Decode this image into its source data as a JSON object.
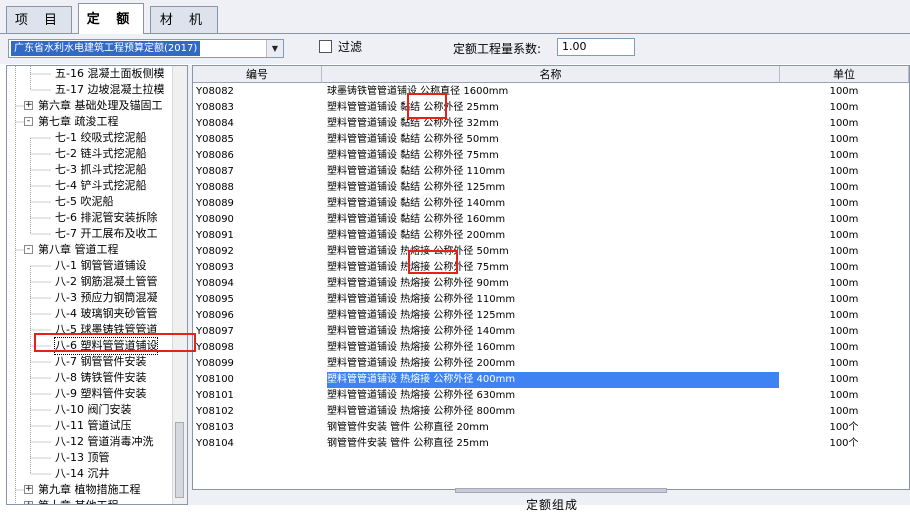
{
  "tabs": [
    {
      "label": "项 目",
      "active": false
    },
    {
      "label": "定 额",
      "active": true
    },
    {
      "label": "材 机",
      "active": false
    }
  ],
  "toolbar": {
    "quota_set": "广东省水利水电建筑工程预算定额(2017)",
    "filter_label": "过滤",
    "coef_label": "定额工程量系数:",
    "coef_value": "1.00"
  },
  "tree": [
    {
      "label": "五-16 混凝土面板侧模",
      "level": 2
    },
    {
      "label": "五-17 边坡混凝土拉模",
      "level": 2
    },
    {
      "label": "第六章 基础处理及锚固工",
      "level": 1,
      "expander": "+"
    },
    {
      "label": "第七章 疏浚工程",
      "level": 1,
      "expander": "-"
    },
    {
      "label": "七-1 绞吸式挖泥船",
      "level": 2
    },
    {
      "label": "七-2 链斗式挖泥船",
      "level": 2
    },
    {
      "label": "七-3 抓斗式挖泥船",
      "level": 2
    },
    {
      "label": "七-4 铲斗式挖泥船",
      "level": 2
    },
    {
      "label": "七-5 吹泥船",
      "level": 2
    },
    {
      "label": "七-6 排泥管安装拆除",
      "level": 2
    },
    {
      "label": "七-7 开工展布及收工",
      "level": 2
    },
    {
      "label": "第八章 管道工程",
      "level": 1,
      "expander": "-"
    },
    {
      "label": "八-1 钢管管道铺设",
      "level": 2
    },
    {
      "label": "八-2 钢筋混凝土管管",
      "level": 2
    },
    {
      "label": "八-3 预应力钢筒混凝",
      "level": 2
    },
    {
      "label": "八-4 玻璃钢夹砂管管",
      "level": 2
    },
    {
      "label": "八-5 球墨铸铁管管道",
      "level": 2
    },
    {
      "label": "八-6 塑料管管道铺设",
      "level": 2,
      "selected": true
    },
    {
      "label": "八-7 钢管管件安装",
      "level": 2
    },
    {
      "label": "八-8 铸铁管件安装",
      "level": 2
    },
    {
      "label": "八-9 塑料管件安装",
      "level": 2
    },
    {
      "label": "八-10 阀门安装",
      "level": 2
    },
    {
      "label": "八-11 管道试压",
      "level": 2
    },
    {
      "label": "八-12 管道消毒冲洗",
      "level": 2
    },
    {
      "label": "八-13 顶管",
      "level": 2
    },
    {
      "label": "八-14 沉井",
      "level": 2
    },
    {
      "label": "第九章 植物措施工程",
      "level": 1,
      "expander": "+"
    },
    {
      "label": "第十章 其他工程",
      "level": 1,
      "expander": "+"
    }
  ],
  "grid": {
    "headers": {
      "code": "编号",
      "name": "名称",
      "unit": "单位"
    },
    "rows": [
      {
        "code": "Y08082",
        "name": "球墨铸铁管管道铺设 公称直径 1600mm",
        "unit": "100m"
      },
      {
        "code": "Y08083",
        "name": "塑料管管道铺设 黏结 公称外径 25mm",
        "unit": "100m"
      },
      {
        "code": "Y08084",
        "name": "塑料管管道铺设 黏结 公称外径 32mm",
        "unit": "100m"
      },
      {
        "code": "Y08085",
        "name": "塑料管管道铺设 黏结 公称外径 50mm",
        "unit": "100m"
      },
      {
        "code": "Y08086",
        "name": "塑料管管道铺设 黏结 公称外径 75mm",
        "unit": "100m"
      },
      {
        "code": "Y08087",
        "name": "塑料管管道铺设 黏结 公称外径 110mm",
        "unit": "100m"
      },
      {
        "code": "Y08088",
        "name": "塑料管管道铺设 黏结 公称外径 125mm",
        "unit": "100m"
      },
      {
        "code": "Y08089",
        "name": "塑料管管道铺设 黏结 公称外径 140mm",
        "unit": "100m"
      },
      {
        "code": "Y08090",
        "name": "塑料管管道铺设 黏结 公称外径 160mm",
        "unit": "100m"
      },
      {
        "code": "Y08091",
        "name": "塑料管管道铺设 黏结 公称外径 200mm",
        "unit": "100m"
      },
      {
        "code": "Y08092",
        "name": "塑料管管道铺设 热熔接 公称外径 50mm",
        "unit": "100m"
      },
      {
        "code": "Y08093",
        "name": "塑料管管道铺设 热熔接 公称外径 75mm",
        "unit": "100m"
      },
      {
        "code": "Y08094",
        "name": "塑料管管道铺设 热熔接 公称外径 90mm",
        "unit": "100m"
      },
      {
        "code": "Y08095",
        "name": "塑料管管道铺设 热熔接 公称外径 110mm",
        "unit": "100m"
      },
      {
        "code": "Y08096",
        "name": "塑料管管道铺设 热熔接 公称外径 125mm",
        "unit": "100m"
      },
      {
        "code": "Y08097",
        "name": "塑料管管道铺设 热熔接 公称外径 140mm",
        "unit": "100m"
      },
      {
        "code": "Y08098",
        "name": "塑料管管道铺设 热熔接 公称外径 160mm",
        "unit": "100m"
      },
      {
        "code": "Y08099",
        "name": "塑料管管道铺设 热熔接 公称外径 200mm",
        "unit": "100m"
      },
      {
        "code": "Y08100",
        "name": "塑料管管道铺设 热熔接 公称外径 400mm",
        "unit": "100m",
        "selected": true
      },
      {
        "code": "Y08101",
        "name": "塑料管管道铺设 热熔接 公称外径 630mm",
        "unit": "100m"
      },
      {
        "code": "Y08102",
        "name": "塑料管管道铺设 热熔接 公称外径 800mm",
        "unit": "100m"
      },
      {
        "code": "Y08103",
        "name": "钢管管件安装 管件 公称直径 20mm",
        "unit": "100个"
      },
      {
        "code": "Y08104",
        "name": "钢管管件安装 管件 公称直径 25mm",
        "unit": "100个"
      }
    ]
  },
  "bottom_panel": {
    "title": "定额组成"
  },
  "colors": {
    "highlight": "#3e82f4",
    "annotation_box": "#e8201a",
    "tab_bg": "#eef0f6"
  }
}
